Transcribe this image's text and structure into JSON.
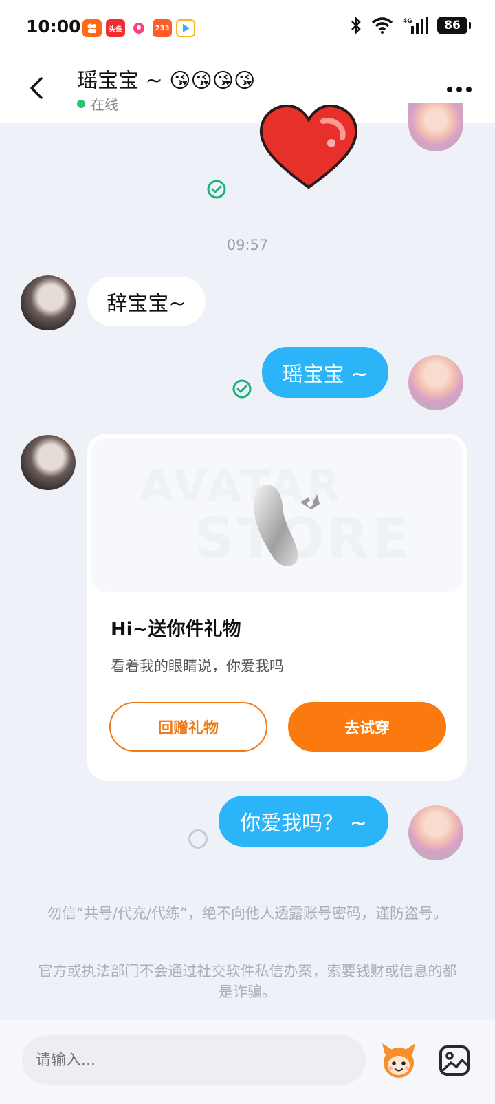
{
  "status_bar": {
    "time": "10:00",
    "app_icons": [
      {
        "name": "kuaishou-app-icon",
        "color": "#ff6a1a",
        "text": ""
      },
      {
        "name": "toutiao-app-icon",
        "color": "#ef2f2f",
        "text": "头条"
      },
      {
        "name": "pink-app-icon",
        "color": "#ffffff",
        "text": ""
      },
      {
        "name": "233-app-icon",
        "color": "#ff5a2a",
        "text": "233"
      },
      {
        "name": "video-app-icon",
        "color": "#ffb21a",
        "text": ""
      }
    ],
    "network": "4G",
    "battery": "86"
  },
  "header": {
    "name": "瑶宝宝 ~ 😘😘😘😘",
    "status": "在线"
  },
  "chat": {
    "timestamp": "09:57",
    "messages": [
      {
        "side": "left",
        "text": "辞宝宝~"
      },
      {
        "side": "right",
        "text": "瑶宝宝 ~"
      },
      {
        "side": "right",
        "text": "你爱我吗？ ~"
      }
    ],
    "gift_card": {
      "watermark_line1": "AVATAR",
      "watermark_line2": "STORE",
      "title": "Hi~送你件礼物",
      "subtitle": "看着我的眼睛说，你爱我吗",
      "return_gift_label": "回赠礼物",
      "try_on_label": "去试穿"
    }
  },
  "notices": {
    "notice1": "勿信“共号/代充/代练”，绝不向他人透露账号密码，谨防盗号。",
    "notice2": "官方或执法部门不会通过社交软件私信办案，索要钱财或信息的都是诈骗。"
  },
  "input": {
    "placeholder": "请输入..."
  },
  "colors": {
    "accent_blue": "#2bb5f8",
    "accent_orange": "#fb7a10",
    "online_green": "#2dc26b",
    "sent_check_green": "#1fb07a"
  }
}
